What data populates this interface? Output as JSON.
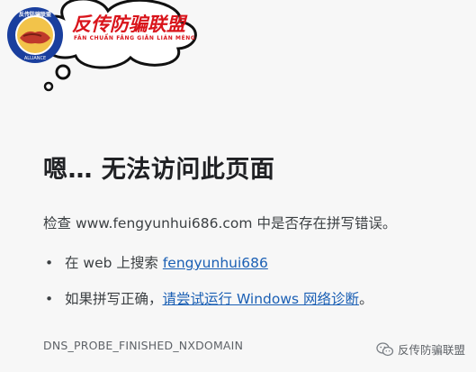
{
  "logo": {
    "title": "反传防骗联盟",
    "subtitle": "FĂN CHUẨN FĀNG GIĀN LIÁN MÉNG",
    "ring_text": "反传防骗联盟",
    "ring_text_bottom": "ALLIANCE"
  },
  "error": {
    "heading": "嗯… 无法访问此页面",
    "check_prefix": "检查 ",
    "check_domain": "www.fengyunhui686.com",
    "check_suffix": " 中是否存在拼写错误。",
    "suggestions": [
      {
        "bullet": "•",
        "prefix": "在 web 上搜索 ",
        "link": "fengyunhui686",
        "suffix": ""
      },
      {
        "bullet": "•",
        "prefix": "如果拼写正确，",
        "link": "请尝试运行 Windows 网络诊断",
        "suffix": "。"
      }
    ],
    "code": "DNS_PROBE_FINISHED_NXDOMAIN"
  },
  "watermark": {
    "icon": "wechat-icon",
    "label": "反传防骗联盟"
  },
  "colors": {
    "brand_red": "#d9141b",
    "link_blue": "#1a5fb4",
    "background": "#f7f7f7"
  }
}
